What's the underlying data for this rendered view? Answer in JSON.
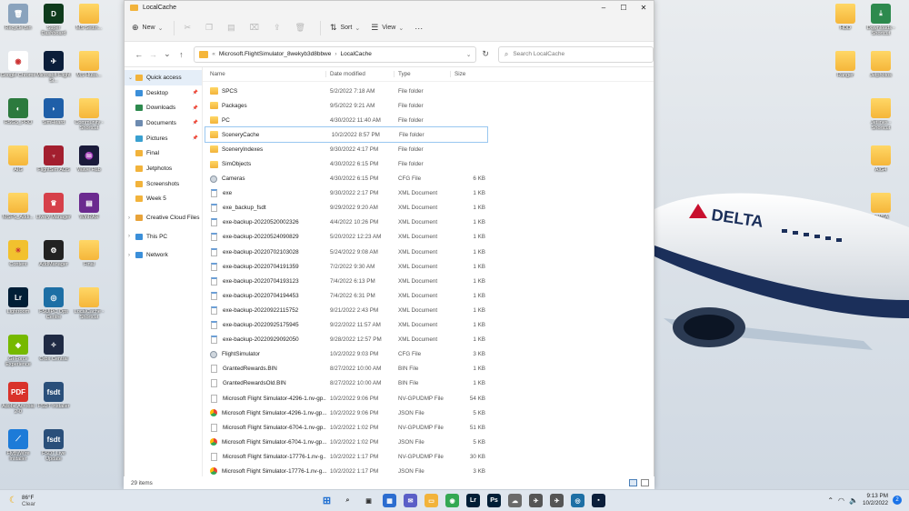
{
  "window": {
    "title": "LocalCache",
    "minimize": "–",
    "maximize": "☐",
    "close": "✕"
  },
  "toolbar": {
    "new": "New",
    "sort": "Sort",
    "view": "View",
    "more": "···"
  },
  "address": {
    "overflow": "«",
    "path1": "Microsoft.FlightSimulator_8wekyb3d8bbwe",
    "path2": "LocalCache",
    "search_placeholder": "Search LocalCache"
  },
  "columns": {
    "name": "Name",
    "date": "Date modified",
    "type": "Type",
    "size": "Size"
  },
  "nav_pane": [
    {
      "label": "Quick access",
      "icon": "star",
      "color": "#f2b33b",
      "arrow": "⌄",
      "pin": false,
      "sel": true
    },
    {
      "label": "Desktop",
      "icon": "desktop",
      "color": "#3b8fd9",
      "arrow": "",
      "pin": true
    },
    {
      "label": "Downloads",
      "icon": "download",
      "color": "#2d8a4e",
      "arrow": "",
      "pin": true
    },
    {
      "label": "Documents",
      "icon": "document",
      "color": "#6d8bb0",
      "arrow": "",
      "pin": true
    },
    {
      "label": "Pictures",
      "icon": "picture",
      "color": "#3aa0d0",
      "arrow": "",
      "pin": true
    },
    {
      "label": "Final",
      "icon": "folder",
      "color": "#f2b33b",
      "arrow": "",
      "pin": false
    },
    {
      "label": "Jetphotos",
      "icon": "folder",
      "color": "#f2b33b",
      "arrow": "",
      "pin": false
    },
    {
      "label": "Screenshots",
      "icon": "folder",
      "color": "#f2b33b",
      "arrow": "",
      "pin": false
    },
    {
      "label": "Week 5",
      "icon": "folder",
      "color": "#f2b33b",
      "arrow": "",
      "pin": false
    },
    {
      "label": "Creative Cloud Files",
      "icon": "cloud",
      "color": "#e8a33a",
      "arrow": "›",
      "pin": false
    },
    {
      "label": "This PC",
      "icon": "pc",
      "color": "#3b8fd9",
      "arrow": "›",
      "pin": false
    },
    {
      "label": "Network",
      "icon": "network",
      "color": "#3b8fd9",
      "arrow": "›",
      "pin": false
    }
  ],
  "files": [
    {
      "name": "SPCS",
      "date": "5/2/2022 7:18 AM",
      "type": "File folder",
      "size": "",
      "kind": "folder"
    },
    {
      "name": "Packages",
      "date": "9/5/2022 9:21 AM",
      "type": "File folder",
      "size": "",
      "kind": "folder"
    },
    {
      "name": "PC",
      "date": "4/30/2022 11:40 AM",
      "type": "File folder",
      "size": "",
      "kind": "folder"
    },
    {
      "name": "SceneryCache",
      "date": "10/2/2022 8:57 PM",
      "type": "File folder",
      "size": "",
      "kind": "folder",
      "sel": true
    },
    {
      "name": "SceneryIndexes",
      "date": "9/30/2022 4:17 PM",
      "type": "File folder",
      "size": "",
      "kind": "folder"
    },
    {
      "name": "SimObjects",
      "date": "4/30/2022 6:15 PM",
      "type": "File folder",
      "size": "",
      "kind": "folder"
    },
    {
      "name": "Cameras",
      "date": "4/30/2022 6:15 PM",
      "type": "CFG File",
      "size": "6 KB",
      "kind": "cfg"
    },
    {
      "name": "exe",
      "date": "9/30/2022 2:17 PM",
      "type": "XML Document",
      "size": "1 KB",
      "kind": "xml"
    },
    {
      "name": "exe_backup_fsdt",
      "date": "9/29/2022 9:20 AM",
      "type": "XML Document",
      "size": "1 KB",
      "kind": "xml"
    },
    {
      "name": "exe-backup-20220520002326",
      "date": "4/4/2022 10:26 PM",
      "type": "XML Document",
      "size": "1 KB",
      "kind": "xml"
    },
    {
      "name": "exe-backup-20220524090829",
      "date": "5/20/2022 12:23 AM",
      "type": "XML Document",
      "size": "1 KB",
      "kind": "xml"
    },
    {
      "name": "exe-backup-20220702103028",
      "date": "5/24/2022 9:08 AM",
      "type": "XML Document",
      "size": "1 KB",
      "kind": "xml"
    },
    {
      "name": "exe-backup-20220704191359",
      "date": "7/2/2022 9:30 AM",
      "type": "XML Document",
      "size": "1 KB",
      "kind": "xml"
    },
    {
      "name": "exe-backup-20220704193123",
      "date": "7/4/2022 6:13 PM",
      "type": "XML Document",
      "size": "1 KB",
      "kind": "xml"
    },
    {
      "name": "exe-backup-20220704194453",
      "date": "7/4/2022 6:31 PM",
      "type": "XML Document",
      "size": "1 KB",
      "kind": "xml"
    },
    {
      "name": "exe-backup-20220922115752",
      "date": "9/21/2022 2:43 PM",
      "type": "XML Document",
      "size": "1 KB",
      "kind": "xml"
    },
    {
      "name": "exe-backup-20220925175945",
      "date": "9/22/2022 11:57 AM",
      "type": "XML Document",
      "size": "1 KB",
      "kind": "xml"
    },
    {
      "name": "exe-backup-20220929092050",
      "date": "9/28/2022 12:57 PM",
      "type": "XML Document",
      "size": "1 KB",
      "kind": "xml"
    },
    {
      "name": "FlightSimulator",
      "date": "10/2/2022 9:03 PM",
      "type": "CFG File",
      "size": "3 KB",
      "kind": "cfg"
    },
    {
      "name": "GrantedRewards.BIN",
      "date": "8/27/2022 10:00 AM",
      "type": "BIN File",
      "size": "1 KB",
      "kind": "doc"
    },
    {
      "name": "GrantedRewardsOld.BIN",
      "date": "8/27/2022 10:00 AM",
      "type": "BIN File",
      "size": "1 KB",
      "kind": "doc"
    },
    {
      "name": "Microsoft Flight Simulator-4296-1.nv-gp...",
      "date": "10/2/2022 9:06 PM",
      "type": "NV-GPUDMP File",
      "size": "54 KB",
      "kind": "doc"
    },
    {
      "name": "Microsoft Flight Simulator-4296-1.nv-gp...",
      "date": "10/2/2022 9:06 PM",
      "type": "JSON File",
      "size": "5 KB",
      "kind": "json"
    },
    {
      "name": "Microsoft Flight Simulator-6704-1.nv-gp...",
      "date": "10/2/2022 1:02 PM",
      "type": "NV-GPUDMP File",
      "size": "51 KB",
      "kind": "doc"
    },
    {
      "name": "Microsoft Flight Simulator-6704-1.nv-gp...",
      "date": "10/2/2022 1:02 PM",
      "type": "JSON File",
      "size": "5 KB",
      "kind": "json"
    },
    {
      "name": "Microsoft Flight Simulator-17776-1.nv-g...",
      "date": "10/2/2022 1:17 PM",
      "type": "NV-GPUDMP File",
      "size": "30 KB",
      "kind": "doc"
    },
    {
      "name": "Microsoft Flight Simulator-17776-1.nv-g...",
      "date": "10/2/2022 1:17 PM",
      "type": "JSON File",
      "size": "3 KB",
      "kind": "json"
    }
  ],
  "status": {
    "count": "29 items"
  },
  "desktop_left": [
    {
      "label": "Recycle Bin",
      "color": "#8aa3bd",
      "glyph": "🗑"
    },
    {
      "label": "Super Dashboard",
      "color": "#0e3b1c",
      "glyph": "D"
    },
    {
      "label": "MS Settin...",
      "color": "folder",
      "glyph": ""
    },
    {
      "label": "Google Chrome",
      "color": "#ffffff",
      "glyph": "◉"
    },
    {
      "label": "Microsoft Flight Si...",
      "color": "#0b1e3a",
      "glyph": "✈"
    },
    {
      "label": "MS Hubs...",
      "color": "folder",
      "glyph": ""
    },
    {
      "label": "RSGS_PRO",
      "color": "#2c7a3e",
      "glyph": "◐"
    },
    {
      "label": "SimHeard",
      "color": "#1f5fa8",
      "glyph": "◗"
    },
    {
      "label": "Community - Shortcut",
      "color": "folder",
      "glyph": ""
    },
    {
      "label": "AIG",
      "color": "folder",
      "glyph": ""
    },
    {
      "label": "FlightSim ADS",
      "color": "#a31f2f",
      "glyph": "♆"
    },
    {
      "label": "Wave Hub",
      "color": "#1a1a3a",
      "glyph": "♒"
    },
    {
      "label": "MSFS_Addi...",
      "color": "folder",
      "glyph": ""
    },
    {
      "label": "Livery Manager",
      "color": "#d6404a",
      "glyph": "♛"
    },
    {
      "label": "WinRAR",
      "color": "#6b2a8f",
      "glyph": "▤"
    },
    {
      "label": "Content",
      "color": "#f2c12e",
      "glyph": "☀"
    },
    {
      "label": "AddManager",
      "color": "#222222",
      "glyph": "⚙"
    },
    {
      "label": "Final",
      "color": "folder",
      "glyph": ""
    },
    {
      "label": "Lightroom",
      "color": "#001e36",
      "glyph": "Lr"
    },
    {
      "label": "FSUIPC Ops Centre",
      "color": "#1d6fa5",
      "glyph": "◎"
    },
    {
      "label": "LocalCache - Shortcut",
      "color": "folder",
      "glyph": ""
    },
    {
      "label": "GeForce Experience",
      "color": "#76b900",
      "glyph": "◈"
    },
    {
      "label": "Orbx Central",
      "color": "#1f2a44",
      "glyph": "✧"
    },
    {
      "label": "",
      "color": "none",
      "glyph": ""
    },
    {
      "label": "Adobe Acrobat 2-0",
      "color": "#d9322a",
      "glyph": "PDF"
    },
    {
      "label": "FSDT Installer",
      "color": "#2a4f7a",
      "glyph": "fsdt"
    },
    {
      "label": "",
      "color": "none",
      "glyph": ""
    },
    {
      "label": "FlyByWire Installer",
      "color": "#1d7bd8",
      "glyph": "⟋"
    },
    {
      "label": "FSDT Live Update",
      "color": "#2a4f7a",
      "glyph": "fsdt"
    }
  ],
  "desktop_right": [
    {
      "label": "HDD",
      "color": "folder",
      "glyph": ""
    },
    {
      "label": "Downloads - Shortcut",
      "color": "#2d8a4e",
      "glyph": "⤓"
    },
    {
      "label": "Ranger",
      "color": "folder",
      "glyph": ""
    },
    {
      "label": "Jetphotos",
      "color": "folder",
      "glyph": ""
    },
    {
      "label": "",
      "color": "none",
      "glyph": ""
    },
    {
      "label": "Jetlines - Shortcut",
      "color": "folder",
      "glyph": ""
    },
    {
      "label": "",
      "color": "none",
      "glyph": ""
    },
    {
      "label": "AIG4",
      "color": "folder",
      "glyph": ""
    },
    {
      "label": "",
      "color": "none",
      "glyph": ""
    },
    {
      "label": "NWSA",
      "color": "folder",
      "glyph": ""
    },
    {
      "label": "",
      "color": "none",
      "glyph": ""
    },
    {
      "label": "Down Unr",
      "color": "folder",
      "glyph": ""
    }
  ],
  "plane": {
    "livery": "DELTA"
  },
  "taskbar": {
    "temp": "86°F",
    "condition": "Clear",
    "time": "9:13 PM",
    "date": "10/2/2022",
    "notifications": "2",
    "apps": [
      {
        "name": "start-icon",
        "glyph": "⊞",
        "color": "#1f6fd1"
      },
      {
        "name": "search-icon",
        "glyph": "⌕",
        "color": "#333333"
      },
      {
        "name": "task-view-icon",
        "glyph": "▣",
        "color": "#333333"
      },
      {
        "name": "widgets-icon",
        "glyph": "▦",
        "color": "#2c6dd0"
      },
      {
        "name": "chat-icon",
        "glyph": "✉",
        "color": "#5b5fc7"
      },
      {
        "name": "file-explorer-icon",
        "glyph": "▭",
        "color": "#f2b33b"
      },
      {
        "name": "chrome-icon",
        "glyph": "◉",
        "color": "#34a853"
      },
      {
        "name": "lightroom-icon",
        "glyph": "Lr",
        "color": "#001e36"
      },
      {
        "name": "photoshop-icon",
        "glyph": "Ps",
        "color": "#001e36"
      },
      {
        "name": "cloud-app-icon",
        "glyph": "☁",
        "color": "#6a6a6a"
      },
      {
        "name": "plane-app-icon",
        "glyph": "✈",
        "color": "#555555"
      },
      {
        "name": "plane-app2-icon",
        "glyph": "✈",
        "color": "#555555"
      },
      {
        "name": "fsuipc-icon",
        "glyph": "◎",
        "color": "#1d6fa5"
      },
      {
        "name": "msfs-icon",
        "glyph": "▪",
        "color": "#0b1e3a"
      }
    ]
  },
  "colors": {
    "accent": "#0067c0",
    "selection": "#99c7f0",
    "folder": "#f2b33b"
  }
}
